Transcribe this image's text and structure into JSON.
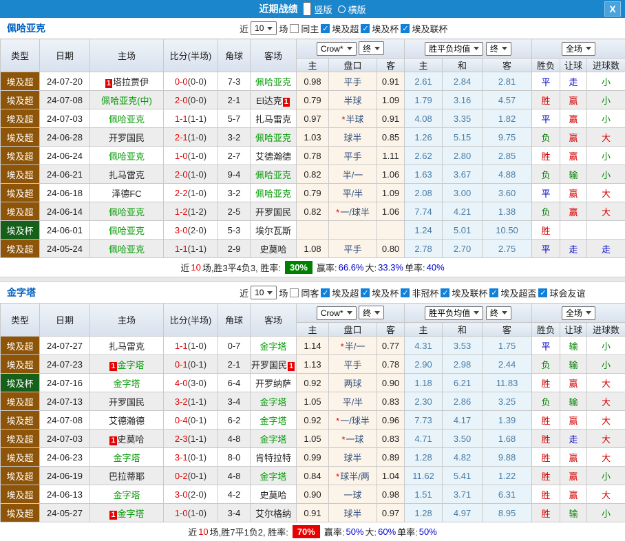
{
  "titlebar": {
    "title": "近期战绩",
    "options": [
      {
        "label": "竖版",
        "selected": true
      },
      {
        "label": "横版",
        "selected": false
      }
    ],
    "close_label": "X"
  },
  "colors": {
    "red": "#d60000",
    "blue": "#0000cc",
    "green": "#008000",
    "score_red": "#e60000",
    "type_super_bg": "#8e5408",
    "type_cup_bg": "#15611a",
    "team_green": "#009900",
    "titlebar_bg": "#1b86cc",
    "summary_green_bg": "#008000",
    "summary_red_bg": "#e80000"
  },
  "columns": {
    "main": [
      "类型",
      "日期",
      "主场",
      "比分(半场)",
      "角球",
      "客场"
    ],
    "sub": [
      "主",
      "盘口",
      "客",
      "主",
      "和",
      "客",
      "胜负",
      "让球",
      "进球数"
    ]
  },
  "sections": [
    {
      "team": "佩哈亚克",
      "near_label": "近",
      "games_value": "10",
      "games_label": "场",
      "same_label": "同主",
      "same_checked": false,
      "leagues": [
        "埃及超",
        "埃及杯",
        "埃及联杯"
      ],
      "selects": [
        "Crow*",
        "终",
        "胜平负均值",
        "终",
        "全场"
      ],
      "rows": [
        {
          "type": "埃及超",
          "date": "24-07-20",
          "home": {
            "pre": "1",
            "text": "塔拉贾伊",
            "green": false
          },
          "score": "0-0",
          "half": "(0-0)",
          "corner": "7-3",
          "away": {
            "text": "佩哈亚克",
            "green": true
          },
          "o1": "0.98",
          "star": false,
          "hc": "平手",
          "o2": "0.91",
          "m1": "2.61",
          "m2": "2.84",
          "m3": "2.81",
          "r1": [
            "平",
            "blue"
          ],
          "r2": [
            "走",
            "blue"
          ],
          "r3": [
            "小",
            "green"
          ]
        },
        {
          "type": "埃及超",
          "date": "24-07-08",
          "home": {
            "text": "佩哈亚克(中)",
            "green": true
          },
          "score": "2-0",
          "half": "(0-0)",
          "corner": "2-1",
          "away": {
            "text": "El达克",
            "post": "1",
            "green": false
          },
          "o1": "0.79",
          "star": false,
          "hc": "半球",
          "o2": "1.09",
          "m1": "1.79",
          "m2": "3.16",
          "m3": "4.57",
          "r1": [
            "胜",
            "red"
          ],
          "r2": [
            "赢",
            "red"
          ],
          "r3": [
            "小",
            "green"
          ]
        },
        {
          "type": "埃及超",
          "date": "24-07-03",
          "home": {
            "text": "佩哈亚克",
            "green": true
          },
          "score": "1-1",
          "half": "(1-1)",
          "corner": "5-7",
          "away": {
            "text": "扎马雷克",
            "green": false
          },
          "o1": "0.97",
          "star": true,
          "hc": "半球",
          "o2": "0.91",
          "m1": "4.08",
          "m2": "3.35",
          "m3": "1.82",
          "r1": [
            "平",
            "blue"
          ],
          "r2": [
            "赢",
            "red"
          ],
          "r3": [
            "小",
            "green"
          ]
        },
        {
          "type": "埃及超",
          "date": "24-06-28",
          "home": {
            "text": "开罗国民",
            "green": false
          },
          "score": "2-1",
          "half": "(1-0)",
          "corner": "3-2",
          "away": {
            "text": "佩哈亚克",
            "green": true
          },
          "o1": "1.03",
          "star": false,
          "hc": "球半",
          "o2": "0.85",
          "m1": "1.26",
          "m2": "5.15",
          "m3": "9.75",
          "r1": [
            "负",
            "green"
          ],
          "r2": [
            "赢",
            "red"
          ],
          "r3": [
            "大",
            "red"
          ]
        },
        {
          "type": "埃及超",
          "date": "24-06-24",
          "home": {
            "text": "佩哈亚克",
            "green": true
          },
          "score": "1-0",
          "half": "(1-0)",
          "corner": "2-7",
          "away": {
            "text": "艾德瀚德",
            "green": false
          },
          "o1": "0.78",
          "star": false,
          "hc": "平手",
          "o2": "1.11",
          "m1": "2.62",
          "m2": "2.80",
          "m3": "2.85",
          "r1": [
            "胜",
            "red"
          ],
          "r2": [
            "赢",
            "red"
          ],
          "r3": [
            "小",
            "green"
          ]
        },
        {
          "type": "埃及超",
          "date": "24-06-21",
          "home": {
            "text": "扎马雷克",
            "green": false
          },
          "score": "2-0",
          "half": "(1-0)",
          "corner": "9-4",
          "away": {
            "text": "佩哈亚克",
            "green": true
          },
          "o1": "0.82",
          "star": false,
          "hc": "半/一",
          "o2": "1.06",
          "m1": "1.63",
          "m2": "3.67",
          "m3": "4.88",
          "r1": [
            "负",
            "green"
          ],
          "r2": [
            "输",
            "green"
          ],
          "r3": [
            "小",
            "green"
          ]
        },
        {
          "type": "埃及超",
          "date": "24-06-18",
          "home": {
            "text": "泽德FC",
            "green": false
          },
          "score": "2-2",
          "half": "(1-0)",
          "corner": "3-2",
          "away": {
            "text": "佩哈亚克",
            "green": true
          },
          "o1": "0.79",
          "star": false,
          "hc": "平/半",
          "o2": "1.09",
          "m1": "2.08",
          "m2": "3.00",
          "m3": "3.60",
          "r1": [
            "平",
            "blue"
          ],
          "r2": [
            "赢",
            "red"
          ],
          "r3": [
            "大",
            "red"
          ]
        },
        {
          "type": "埃及超",
          "date": "24-06-14",
          "home": {
            "text": "佩哈亚克",
            "green": true
          },
          "score": "1-2",
          "half": "(1-2)",
          "corner": "2-5",
          "away": {
            "text": "开罗国民",
            "green": false
          },
          "o1": "0.82",
          "star": true,
          "hc": "一/球半",
          "o2": "1.06",
          "m1": "7.74",
          "m2": "4.21",
          "m3": "1.38",
          "r1": [
            "负",
            "green"
          ],
          "r2": [
            "赢",
            "red"
          ],
          "r3": [
            "大",
            "red"
          ]
        },
        {
          "type": "埃及杯",
          "date": "24-06-01",
          "home": {
            "text": "佩哈亚克",
            "green": true
          },
          "score": "3-0",
          "half": "(2-0)",
          "corner": "5-3",
          "away": {
            "text": "埃尔瓦斯",
            "green": false
          },
          "o1": "",
          "star": false,
          "hc": "",
          "o2": "",
          "m1": "1.24",
          "m2": "5.01",
          "m3": "10.50",
          "r1": [
            "胜",
            "red"
          ],
          "r2": null,
          "r3": null
        },
        {
          "type": "埃及超",
          "date": "24-05-24",
          "home": {
            "text": "佩哈亚克",
            "green": true
          },
          "score": "1-1",
          "half": "(1-1)",
          "corner": "2-9",
          "away": {
            "text": "史莫哈",
            "green": false
          },
          "o1": "1.08",
          "star": false,
          "hc": "平手",
          "o2": "0.80",
          "m1": "2.78",
          "m2": "2.70",
          "m3": "2.75",
          "r1": [
            "平",
            "blue"
          ],
          "r2": [
            "走",
            "blue"
          ],
          "r3": [
            "走",
            "blue"
          ]
        }
      ],
      "summary": {
        "pre": "近",
        "n": "10",
        "mid": "场,胜3平4负3, 胜率:",
        "rate": "30%",
        "rate_bg": "#008000",
        "stats": [
          {
            "label": "赢率:",
            "value": "66.6%"
          },
          {
            "label": "大:",
            "value": "33.3%"
          },
          {
            "label": "单率:",
            "value": "40%"
          }
        ]
      }
    },
    {
      "team": "金字塔",
      "near_label": "近",
      "games_value": "10",
      "games_label": "场",
      "same_label": "同客",
      "same_checked": false,
      "leagues": [
        "埃及超",
        "埃及杯",
        "非冠杯",
        "埃及联杯",
        "埃及超盃",
        "球会友谊"
      ],
      "selects": [
        "Crow*",
        "终",
        "胜平负均值",
        "终",
        "全场"
      ],
      "rows": [
        {
          "type": "埃及超",
          "date": "24-07-27",
          "home": {
            "text": "扎马雷克",
            "green": false
          },
          "score": "1-1",
          "half": "(1-0)",
          "corner": "0-7",
          "away": {
            "text": "金字塔",
            "green": true
          },
          "o1": "1.14",
          "star": true,
          "hc": "半/一",
          "o2": "0.77",
          "m1": "4.31",
          "m2": "3.53",
          "m3": "1.75",
          "r1": [
            "平",
            "blue"
          ],
          "r2": [
            "输",
            "green"
          ],
          "r3": [
            "小",
            "green"
          ]
        },
        {
          "type": "埃及超",
          "date": "24-07-23",
          "home": {
            "pre": "1",
            "text": "金字塔",
            "green": true
          },
          "score": "0-1",
          "half": "(0-1)",
          "corner": "2-1",
          "away": {
            "text": "开罗国民",
            "post": "1",
            "green": false
          },
          "o1": "1.13",
          "star": false,
          "hc": "平手",
          "o2": "0.78",
          "m1": "2.90",
          "m2": "2.98",
          "m3": "2.44",
          "r1": [
            "负",
            "green"
          ],
          "r2": [
            "输",
            "green"
          ],
          "r3": [
            "小",
            "green"
          ]
        },
        {
          "type": "埃及杯",
          "date": "24-07-16",
          "home": {
            "text": "金字塔",
            "green": true
          },
          "score": "4-0",
          "half": "(3-0)",
          "corner": "6-4",
          "away": {
            "text": "开罗纳萨",
            "green": false
          },
          "o1": "0.92",
          "star": false,
          "hc": "两球",
          "o2": "0.90",
          "m1": "1.18",
          "m2": "6.21",
          "m3": "11.83",
          "r1": [
            "胜",
            "red"
          ],
          "r2": [
            "赢",
            "red"
          ],
          "r3": [
            "大",
            "red"
          ]
        },
        {
          "type": "埃及超",
          "date": "24-07-13",
          "home": {
            "text": "开罗国民",
            "green": false
          },
          "score": "3-2",
          "half": "(1-1)",
          "corner": "3-4",
          "away": {
            "text": "金字塔",
            "green": true
          },
          "o1": "1.05",
          "star": false,
          "hc": "平/半",
          "o2": "0.83",
          "m1": "2.30",
          "m2": "2.86",
          "m3": "3.25",
          "r1": [
            "负",
            "green"
          ],
          "r2": [
            "输",
            "green"
          ],
          "r3": [
            "大",
            "red"
          ]
        },
        {
          "type": "埃及超",
          "date": "24-07-08",
          "home": {
            "text": "艾德瀚德",
            "green": false
          },
          "score": "0-4",
          "half": "(0-1)",
          "corner": "6-2",
          "away": {
            "text": "金字塔",
            "green": true
          },
          "o1": "0.92",
          "star": true,
          "hc": "一/球半",
          "o2": "0.96",
          "m1": "7.73",
          "m2": "4.17",
          "m3": "1.39",
          "r1": [
            "胜",
            "red"
          ],
          "r2": [
            "赢",
            "red"
          ],
          "r3": [
            "大",
            "red"
          ]
        },
        {
          "type": "埃及超",
          "date": "24-07-03",
          "home": {
            "pre": "1",
            "text": "史莫哈",
            "green": false
          },
          "score": "2-3",
          "half": "(1-1)",
          "corner": "4-8",
          "away": {
            "text": "金字塔",
            "green": true
          },
          "o1": "1.05",
          "star": true,
          "hc": "一球",
          "o2": "0.83",
          "m1": "4.71",
          "m2": "3.50",
          "m3": "1.68",
          "r1": [
            "胜",
            "red"
          ],
          "r2": [
            "走",
            "blue"
          ],
          "r3": [
            "大",
            "red"
          ]
        },
        {
          "type": "埃及超",
          "date": "24-06-23",
          "home": {
            "text": "金字塔",
            "green": true
          },
          "score": "3-1",
          "half": "(0-1)",
          "corner": "8-0",
          "away": {
            "text": "肯特拉特",
            "green": false
          },
          "o1": "0.99",
          "star": false,
          "hc": "球半",
          "o2": "0.89",
          "m1": "1.28",
          "m2": "4.82",
          "m3": "9.88",
          "r1": [
            "胜",
            "red"
          ],
          "r2": [
            "赢",
            "red"
          ],
          "r3": [
            "大",
            "red"
          ]
        },
        {
          "type": "埃及超",
          "date": "24-06-19",
          "home": {
            "text": "巴拉蒂耶",
            "green": false
          },
          "score": "0-2",
          "half": "(0-1)",
          "corner": "4-8",
          "away": {
            "text": "金字塔",
            "green": true
          },
          "o1": "0.84",
          "star": true,
          "hc": "球半/两",
          "o2": "1.04",
          "m1": "11.62",
          "m2": "5.41",
          "m3": "1.22",
          "r1": [
            "胜",
            "red"
          ],
          "r2": [
            "赢",
            "red"
          ],
          "r3": [
            "小",
            "green"
          ]
        },
        {
          "type": "埃及超",
          "date": "24-06-13",
          "home": {
            "text": "金字塔",
            "green": true
          },
          "score": "3-0",
          "half": "(2-0)",
          "corner": "4-2",
          "away": {
            "text": "史莫哈",
            "green": false
          },
          "o1": "0.90",
          "star": false,
          "hc": "一球",
          "o2": "0.98",
          "m1": "1.51",
          "m2": "3.71",
          "m3": "6.31",
          "r1": [
            "胜",
            "red"
          ],
          "r2": [
            "赢",
            "red"
          ],
          "r3": [
            "大",
            "red"
          ]
        },
        {
          "type": "埃及超",
          "date": "24-05-27",
          "home": {
            "pre": "1",
            "text": "金字塔",
            "green": true
          },
          "score": "1-0",
          "half": "(1-0)",
          "corner": "3-4",
          "away": {
            "text": "艾尔格纳",
            "green": false
          },
          "o1": "0.91",
          "star": false,
          "hc": "球半",
          "o2": "0.97",
          "m1": "1.28",
          "m2": "4.97",
          "m3": "8.95",
          "r1": [
            "胜",
            "red"
          ],
          "r2": [
            "输",
            "green"
          ],
          "r3": [
            "小",
            "green"
          ]
        }
      ],
      "summary": {
        "pre": "近",
        "n": "10",
        "mid": "场,胜7平1负2, 胜率:",
        "rate": "70%",
        "rate_bg": "#e80000",
        "stats": [
          {
            "label": "赢率:",
            "value": "50%"
          },
          {
            "label": "大:",
            "value": "60%"
          },
          {
            "label": "单率:",
            "value": "50%"
          }
        ]
      }
    }
  ]
}
